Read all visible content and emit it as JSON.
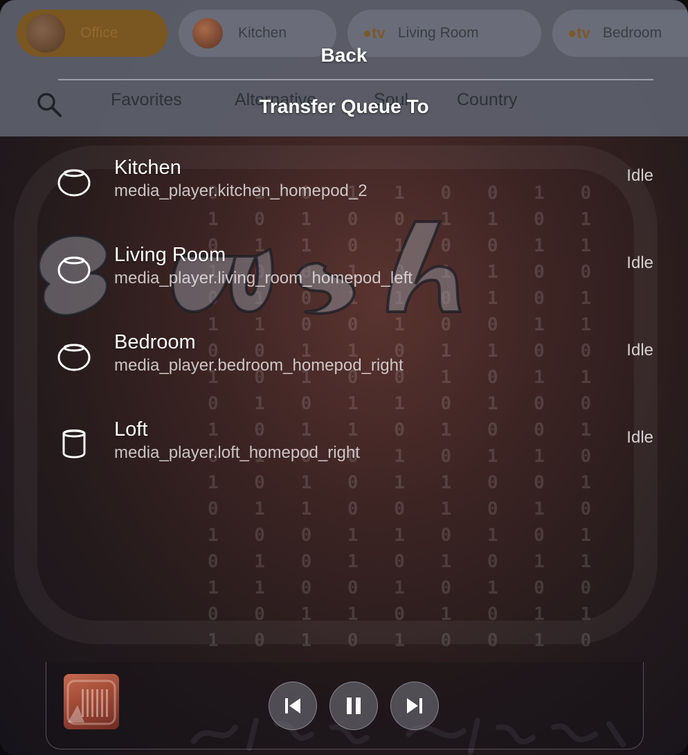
{
  "header": {
    "back_label": "Back",
    "title": "Transfer Queue To",
    "players": [
      {
        "label": "Office",
        "active": true,
        "badge": ""
      },
      {
        "label": "Kitchen",
        "active": false,
        "badge": ""
      },
      {
        "label": "Living Room",
        "active": false,
        "badge": "tv"
      },
      {
        "label": "Bedroom",
        "active": false,
        "badge": "tv"
      }
    ],
    "tabs": [
      "Favorites",
      "Alternative",
      "Soul",
      "Country"
    ]
  },
  "devices": [
    {
      "name": "Kitchen",
      "entity": "media_player.kitchen_homepod_2",
      "state": "Idle",
      "icon": "homepod-mini-icon"
    },
    {
      "name": "Living Room",
      "entity": "media_player.living_room_homepod_left",
      "state": "Idle",
      "icon": "homepod-mini-icon"
    },
    {
      "name": "Bedroom",
      "entity": "media_player.bedroom_homepod_right",
      "state": "Idle",
      "icon": "homepod-mini-icon"
    },
    {
      "name": "Loft",
      "entity": "media_player.loft_homepod_right",
      "state": "Idle",
      "icon": "homepod-icon"
    }
  ],
  "player": {
    "controls": [
      "previous-track-icon",
      "pause-icon",
      "next-track-icon"
    ]
  },
  "colors": {
    "active_chip": "#7a5620",
    "header_bg": "#5c606c",
    "text_primary": "#ffffff"
  }
}
